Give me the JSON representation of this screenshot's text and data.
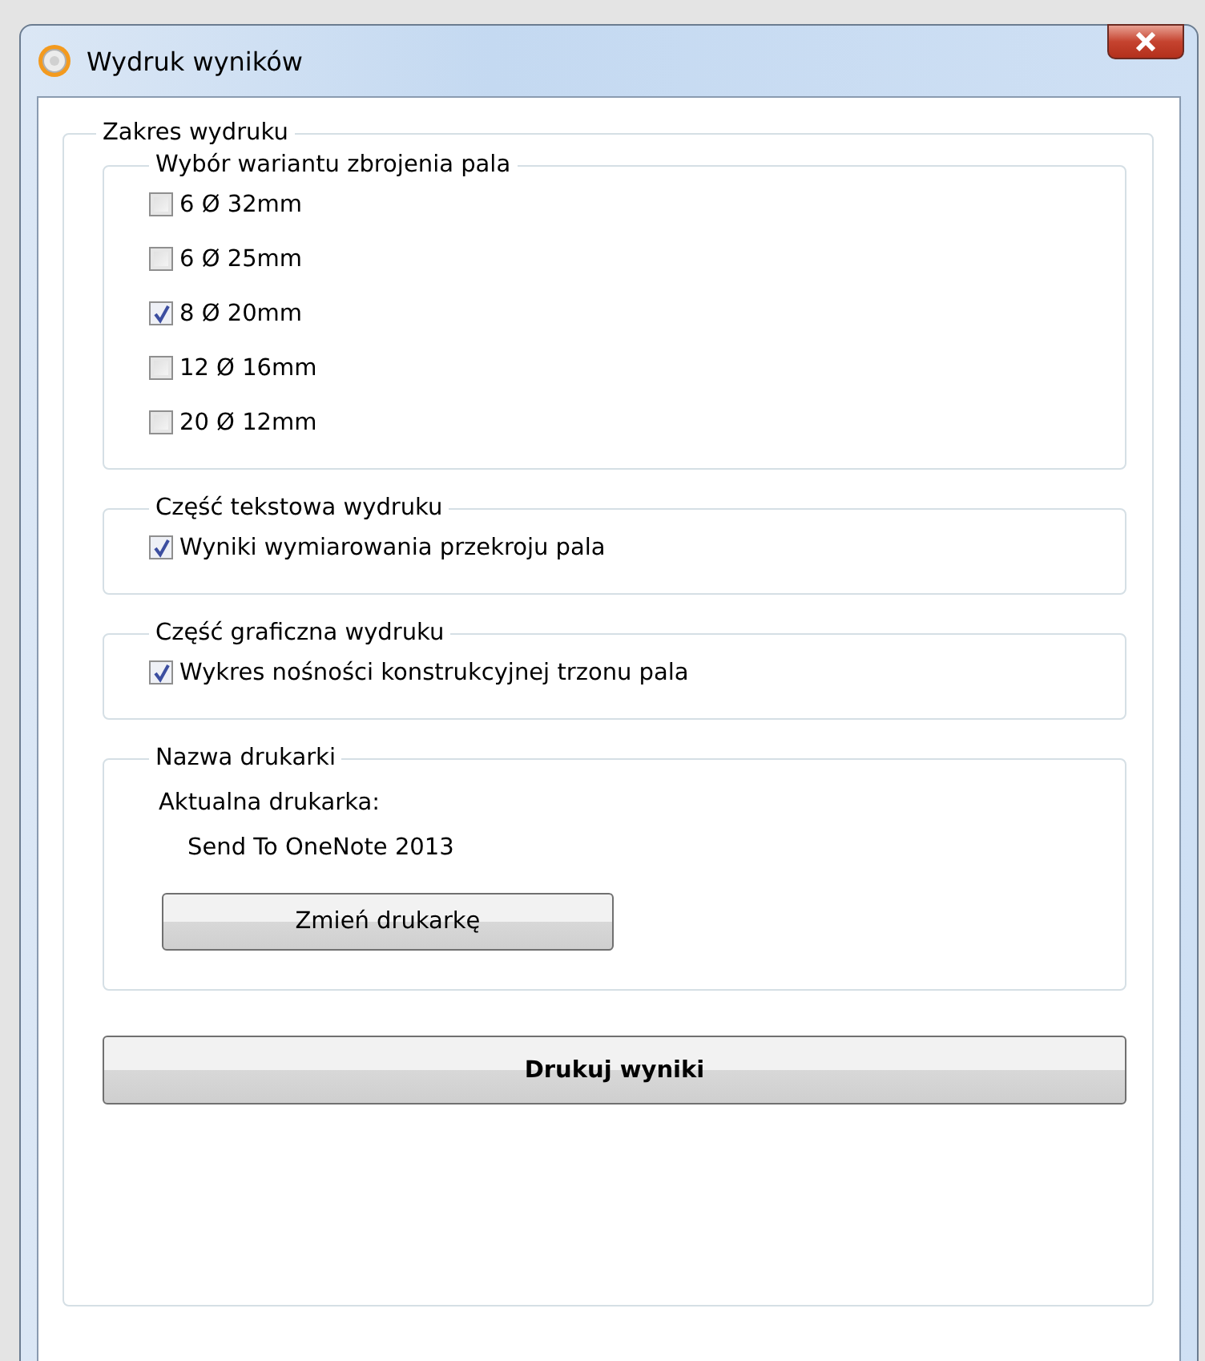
{
  "window": {
    "title": "Wydruk wyników"
  },
  "print_range": {
    "legend": "Zakres wydruku",
    "sections": [
      {
        "kind": "checkboxes",
        "legend": "Wybór wariantu zbrojenia pala",
        "items": [
          {
            "label": "6 Ø 32mm",
            "checked": false
          },
          {
            "label": "6 Ø 25mm",
            "checked": false
          },
          {
            "label": "8 Ø 20mm",
            "checked": true
          },
          {
            "label": "12 Ø 16mm",
            "checked": false
          },
          {
            "label": "20 Ø 12mm",
            "checked": false
          }
        ]
      },
      {
        "kind": "checkboxes",
        "legend": "Część tekstowa wydruku",
        "items": [
          {
            "label": "Wyniki wymiarowania przekroju pala",
            "checked": true
          }
        ]
      },
      {
        "kind": "checkboxes",
        "legend": "Część graficzna wydruku",
        "items": [
          {
            "label": "Wykres nośności konstrukcyjnej trzonu pala",
            "checked": true
          }
        ]
      },
      {
        "kind": "printer",
        "legend": "Nazwa drukarki",
        "label": "Aktualna drukarka:",
        "printer": "Send To OneNote 2013",
        "button": "Zmień drukarkę"
      }
    ],
    "print_button": "Drukuj wyniki"
  }
}
